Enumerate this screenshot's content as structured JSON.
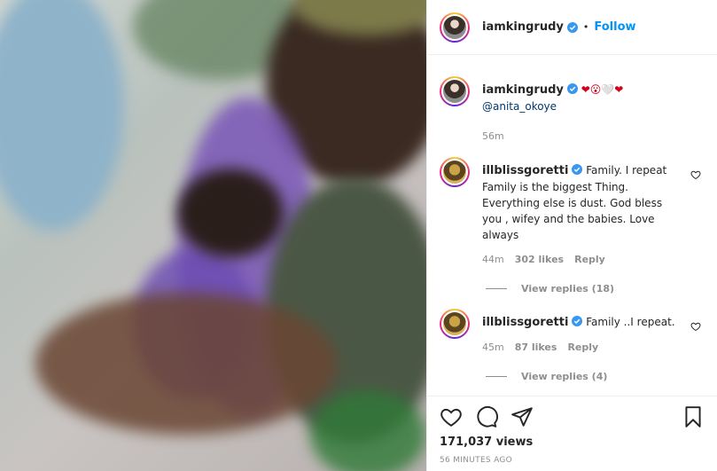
{
  "post": {
    "author": "iamkingrudy",
    "follow_label": "Follow",
    "dot": "•"
  },
  "caption": {
    "username": "iamkingrudy",
    "text": "❤😮🤍❤",
    "mention": "@anita_okoye",
    "time": "56m"
  },
  "comments": [
    {
      "username": "illblissgoretti",
      "text": "Family. I repeat Family is the biggest Thing. Everything else is dust. God bless you , wifey and the babies. Love always",
      "time": "44m",
      "likes": "302 likes",
      "reply_label": "Reply",
      "view_replies": "View replies (18)"
    },
    {
      "username": "illblissgoretti",
      "text": "Family ..I repeat.",
      "time": "45m",
      "likes": "87 likes",
      "reply_label": "Reply",
      "view_replies": "View replies (4)"
    }
  ],
  "stats": {
    "views": "171,037 views",
    "posted": "56 MINUTES AGO"
  },
  "icons": {
    "like": "heart-icon",
    "comment": "comment-icon",
    "share": "send-icon",
    "save": "bookmark-icon",
    "verified": "verified-badge-icon"
  },
  "colors": {
    "accent": "#0095f6",
    "verified": "#3897f0",
    "muted": "#8e8e8e"
  }
}
